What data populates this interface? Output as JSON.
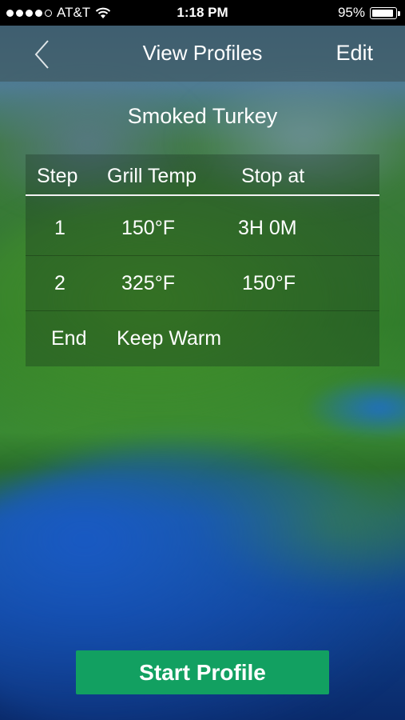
{
  "status_bar": {
    "carrier": "AT&T",
    "time": "1:18 PM",
    "battery_percent": "95%",
    "battery_level": 0.95,
    "signal_bars": 4,
    "icons": [
      "signal-icon",
      "wifi-icon",
      "battery-icon"
    ]
  },
  "navbar": {
    "back_icon": "chevron-left-icon",
    "title": "View Profiles",
    "edit_label": "Edit"
  },
  "profile": {
    "name": "Smoked Turkey",
    "columns": [
      "Step",
      "Grill Temp",
      "Stop at"
    ],
    "rows": [
      {
        "step": "1",
        "grill_temp": "150°F",
        "stop_at": "3H 0M"
      },
      {
        "step": "2",
        "grill_temp": "325°F",
        "stop_at": "150°F"
      },
      {
        "step": "End",
        "grill_temp": "Keep Warm",
        "stop_at": ""
      }
    ]
  },
  "actions": {
    "start_label": "Start Profile",
    "start_color": "#12a061"
  }
}
